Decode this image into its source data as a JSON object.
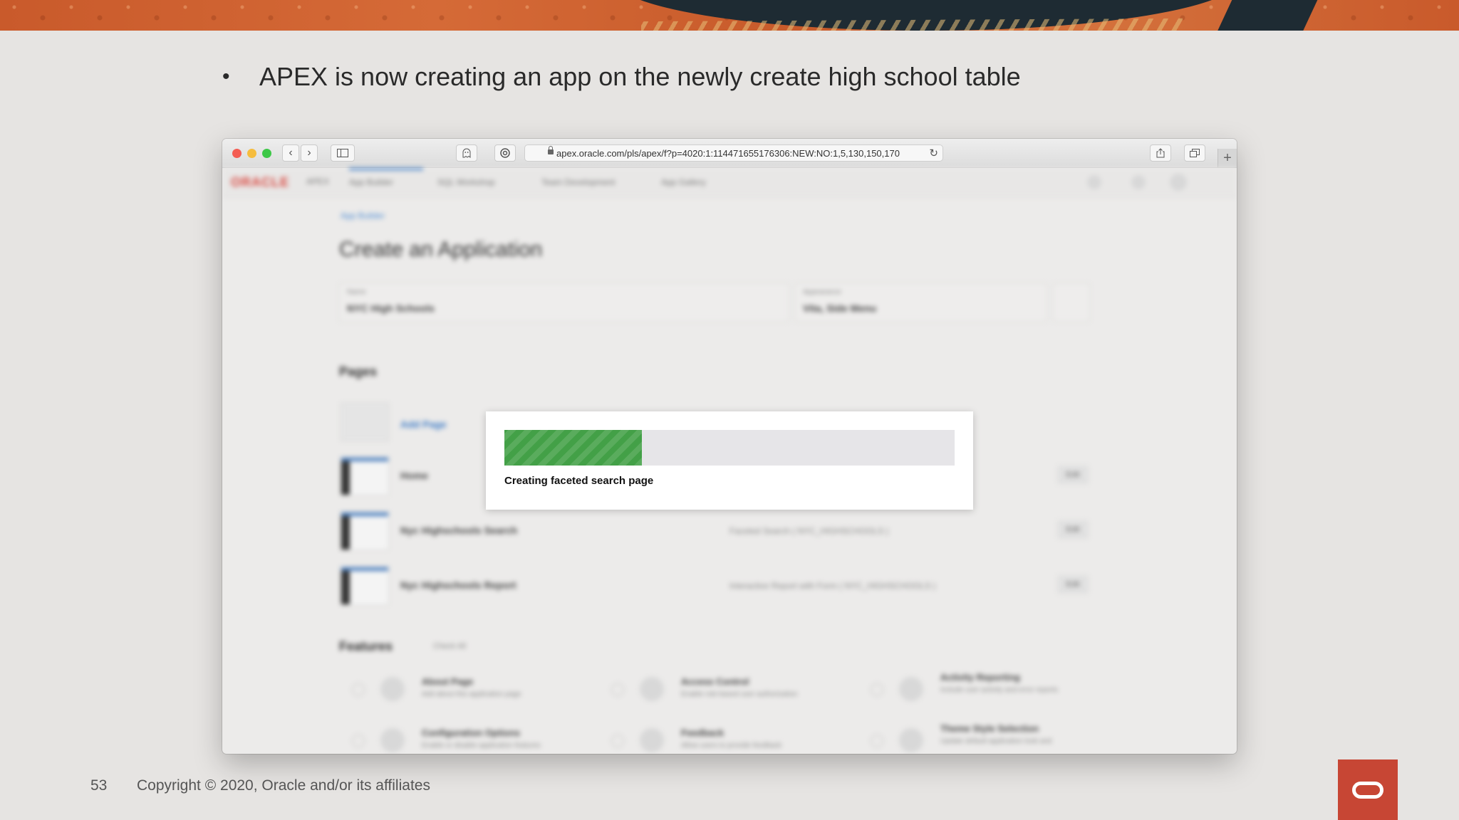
{
  "slide": {
    "bullet_text": "APEX is now creating an app on the newly create high school table",
    "page_number": "53",
    "copyright": "Copyright © 2020, Oracle and/or its affiliates"
  },
  "browser": {
    "url": "apex.oracle.com/pls/apex/f?p=4020:1:114471655176306:NEW:NO:1,5,130,150,170",
    "buttons": {
      "back": "‹",
      "forward": "›",
      "reload": "↻",
      "add_tab": "+"
    }
  },
  "app": {
    "logo": "ORACLE",
    "logo_sub": "APEX",
    "nav_items": [
      "App Builder",
      "SQL Workshop",
      "Team Development",
      "App Gallery"
    ],
    "breadcrumb": "App Builder",
    "title": "Create an Application",
    "name_label": "Name",
    "name_value": "NYC High Schools",
    "appearance_label": "Appearance",
    "appearance_value": "Vita, Side Menu",
    "pages_heading": "Pages",
    "add_page": "Add Page",
    "pages": [
      {
        "name": "Home",
        "type": "",
        "edit": "Edit"
      },
      {
        "name": "Nyc Highschools Search",
        "type": "Faceted Search ( NYC_HIGHSCHOOLS )",
        "edit": "Edit"
      },
      {
        "name": "Nyc Highschools Report",
        "type": "Interactive Report with Form ( NYC_HIGHSCHOOLS )",
        "edit": "Edit"
      }
    ],
    "features_heading": "Features",
    "check_all": "Check All",
    "features": [
      {
        "name": "About Page",
        "desc": "Add about this application page"
      },
      {
        "name": "Access Control",
        "desc": "Enable role-based user authorization"
      },
      {
        "name": "Activity Reporting",
        "desc": "Include user activity and error reports"
      },
      {
        "name": "Configuration Options",
        "desc": "Enable or disable application features"
      },
      {
        "name": "Feedback",
        "desc": "Allow users to provide feedback"
      },
      {
        "name": "Theme Style Selection",
        "desc": "Update default application look and"
      }
    ]
  },
  "dialog": {
    "progress": 0.306,
    "label": "Creating faceted search page"
  },
  "colors": {
    "progress_fill": "#43a047",
    "oracle_red": "#c74634"
  }
}
